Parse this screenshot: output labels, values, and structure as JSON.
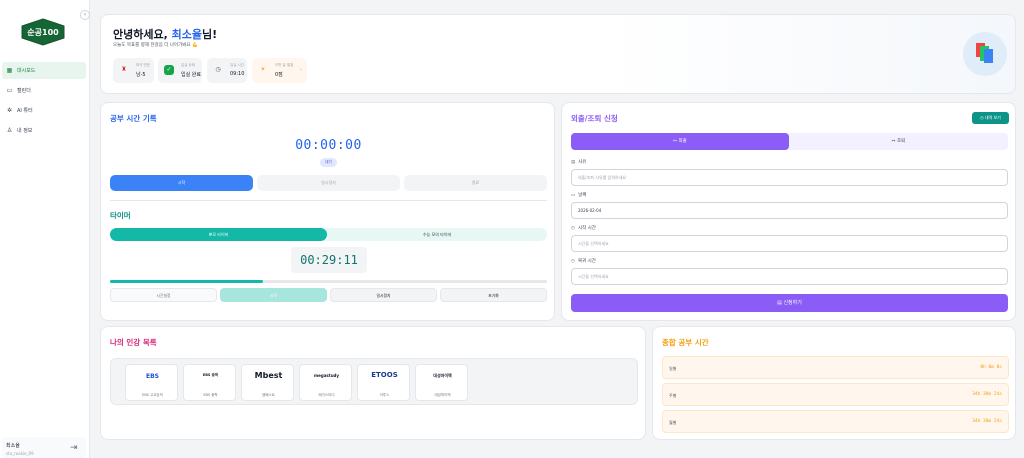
{
  "sidebar": {
    "logo_text": "순공100",
    "items": [
      {
        "label": "대시보드",
        "icon": "grid-icon",
        "active": true
      },
      {
        "label": "캘린더",
        "icon": "calendar-icon",
        "active": false
      },
      {
        "label": "AI 튜터",
        "icon": "brain-icon",
        "active": false
      },
      {
        "label": "내 정보",
        "icon": "user-icon",
        "active": false
      }
    ],
    "user": {
      "name": "최소율",
      "id": "stu_rookie_09"
    }
  },
  "welcome": {
    "greeting": "안녕하세요, ",
    "name": "최소율",
    "suffix": "님!",
    "subtitle": "오늘도 목표를 향해 한걸음 더 나아가봐요 💪",
    "chips": [
      {
        "label": "좌석 번호",
        "value": "낭-5"
      },
      {
        "label": "입실 상태",
        "value": "입실 완료"
      },
      {
        "label": "입실 시간",
        "value": "09:10"
      },
      {
        "label": "이번 달 벌점",
        "value": "0점"
      }
    ]
  },
  "study": {
    "title": "공부 시간 기록",
    "timer": "00:00:00",
    "status": "대기",
    "buttons": [
      "시작",
      "일시정지",
      "종료"
    ],
    "timer_section_title": "타이머",
    "timer_tabs": [
      "뽀모 타이머",
      "수능 모의 타이머"
    ],
    "pomodoro": "00:29:11",
    "progress": 0.35,
    "controls": [
      "시간설정",
      "시작",
      "일시정지",
      "초기화"
    ]
  },
  "outing": {
    "title": "외출/조퇴 신청",
    "history_button": "내역 보기",
    "tabs": [
      "외출",
      "조퇴"
    ],
    "fields": [
      {
        "label": "사유",
        "placeholder": "외출/조퇴 사유를 입력하세요",
        "value": ""
      },
      {
        "label": "날짜",
        "placeholder": "",
        "value": "2026-02-04"
      },
      {
        "label": "시작 시간",
        "placeholder": "시간을 선택하세요",
        "value": ""
      },
      {
        "label": "복귀 시간",
        "placeholder": "시간을 선택하세요",
        "value": ""
      }
    ],
    "submit": "신청하기"
  },
  "lectures": {
    "title": "나의 인강 목록",
    "items": [
      {
        "logo": "EBS",
        "name": "EBS 고교강의"
      },
      {
        "logo": "EBS 중학",
        "name": "EBS 중학"
      },
      {
        "logo": "Mbest",
        "name": "엠베스트"
      },
      {
        "logo": "megastudy",
        "name": "메가스터디"
      },
      {
        "logo": "ETOOS",
        "name": "이투스"
      },
      {
        "logo": "대성마이맥",
        "name": "대성마이맥"
      }
    ]
  },
  "total": {
    "title": "종합 공부 시간",
    "rows": [
      {
        "label": "일별",
        "value": "0h 0m 0s"
      },
      {
        "label": "주별",
        "value": "34h 38m 24s"
      },
      {
        "label": "월별",
        "value": "34h 38m 24s"
      }
    ]
  },
  "colors": {
    "brand_green": "#15803d",
    "primary_blue": "#2563eb",
    "teal": "#14b8a6",
    "purple": "#8b5cf6",
    "orange": "#f59e0b",
    "pink": "#db2777"
  }
}
